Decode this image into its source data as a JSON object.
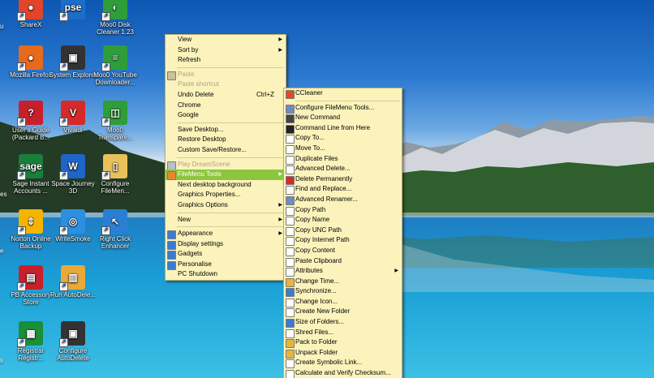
{
  "desktop": {
    "colors": {
      "menu_bg": "#fbf3bb",
      "highlight": "#8cc63e"
    },
    "edge_labels": [
      "u",
      "es",
      "e",
      "s"
    ],
    "icons": [
      {
        "label": "ShareX",
        "color": "#e0452c",
        "glyph": "●",
        "name": "sharex-icon"
      },
      {
        "label": "Mozilla Firefox",
        "color": "#e66a1d",
        "glyph": "●",
        "name": "firefox-icon"
      },
      {
        "label": "User's Guide (Packard B...",
        "color": "#c8202a",
        "glyph": "?",
        "name": "help-icon"
      },
      {
        "label": "Sage Instant Accounts ...",
        "color": "#1a7f3c",
        "glyph": "sage",
        "name": "sage-icon"
      },
      {
        "label": "Norton Online Backup",
        "color": "#f4b400",
        "glyph": "⇕",
        "name": "norton-icon"
      },
      {
        "label": "PB Accessory Store",
        "color": "#c8202a",
        "glyph": "▤",
        "name": "store-icon"
      },
      {
        "label": "Registrar Registr...",
        "color": "#1a8f3a",
        "glyph": "▦",
        "name": "registrar-icon"
      },
      {
        "label": "",
        "color": "#1b6fc8",
        "glyph": "pse",
        "name": "pse-icon"
      },
      {
        "label": "System Explorer",
        "color": "#333333",
        "glyph": "▣",
        "name": "system-explorer-icon"
      },
      {
        "label": "Vivaldi",
        "color": "#d42a2a",
        "glyph": "V",
        "name": "vivaldi-icon"
      },
      {
        "label": "Space Journey 3D",
        "color": "#1f64c8",
        "glyph": "W",
        "name": "space-journey-icon"
      },
      {
        "label": "WriteSmoke",
        "color": "#2c8fe0",
        "glyph": "◎",
        "name": "writesmoke-icon"
      },
      {
        "label": "Run AutoDele...",
        "color": "#e8a93a",
        "glyph": "▥",
        "name": "autodelete-run-icon"
      },
      {
        "label": "Configure AutoDelete",
        "color": "#333333",
        "glyph": "▣",
        "name": "configure-autodelete-icon"
      },
      {
        "label": "Moo0 Disk Cleaner 1.23",
        "color": "#2e9d3a",
        "glyph": "◐",
        "name": "moo0-disk-icon"
      },
      {
        "label": "Moo0 YouTube Downloader...",
        "color": "#2e9d3a",
        "glyph": "≡",
        "name": "moo0-youtube-icon"
      },
      {
        "label": "Moo0 Transpare...",
        "color": "#2e9d3a",
        "glyph": "◫",
        "name": "moo0-transparent-icon"
      },
      {
        "label": "Configure FileMen...",
        "color": "#e8c15a",
        "glyph": "▯",
        "name": "configure-filemenu-icon"
      },
      {
        "label": "Right Click Enhancer",
        "color": "#2a7fd4",
        "glyph": "↖",
        "name": "right-click-enhancer-icon"
      }
    ]
  },
  "context_menu": {
    "items": [
      {
        "label": "View",
        "arrow": true
      },
      {
        "label": "Sort by",
        "arrow": true
      },
      {
        "label": "Refresh"
      },
      {
        "sep": true
      },
      {
        "label": "Paste",
        "disabled": true,
        "icon": "#c9c19a",
        "icon_name": "paste-icon"
      },
      {
        "label": "Paste shortcut",
        "disabled": true
      },
      {
        "label": "Undo Delete",
        "shortcut": "Ctrl+Z"
      },
      {
        "label": "Chrome"
      },
      {
        "label": "Google"
      },
      {
        "sep": true
      },
      {
        "label": "Save Desktop..."
      },
      {
        "label": "Restore Desktop"
      },
      {
        "label": "Custom Save/Restore..."
      },
      {
        "sep": true
      },
      {
        "label": "Play DreamScene",
        "disabled": true,
        "icon": "#b7c0c8",
        "icon_name": "dreamscene-icon"
      },
      {
        "label": "FileMenu Tools",
        "arrow": true,
        "highlighted": true,
        "icon": "#e38a2e",
        "icon_name": "filemenu-icon"
      },
      {
        "label": "Next desktop background"
      },
      {
        "label": "Graphics Properties..."
      },
      {
        "label": "Graphics Options",
        "arrow": true
      },
      {
        "sep": true
      },
      {
        "label": "New",
        "arrow": true
      },
      {
        "sep": true
      },
      {
        "label": "Appearance",
        "arrow": true,
        "icon": "#3c7bd1",
        "icon_name": "appearance-icon"
      },
      {
        "label": "Display settings",
        "icon": "#3c7bd1",
        "icon_name": "display-icon"
      },
      {
        "label": "Gadgets",
        "icon": "#3c7bd1",
        "icon_name": "gadgets-icon"
      },
      {
        "label": "Personalise",
        "icon": "#3c7bd1",
        "icon_name": "personalise-icon"
      },
      {
        "label": "PC Shutdown"
      }
    ]
  },
  "filemenu_submenu": {
    "items": [
      {
        "label": "CCleaner",
        "icon": "#e04b2a",
        "icon_name": "ccleaner-icon"
      },
      {
        "sep": true
      },
      {
        "label": "Configure FileMenu Tools...",
        "icon": "#6c8ebf",
        "icon_name": "configure-icon"
      },
      {
        "label": "New Command",
        "icon": "#444444",
        "icon_name": "new-command-icon"
      },
      {
        "label": "Command Line from Here",
        "icon": "#222222",
        "icon_name": "command-line-icon"
      },
      {
        "label": "Copy To...",
        "icon": "#ffffff",
        "icon_name": "copy-to-icon"
      },
      {
        "label": "Move To...",
        "icon": "#ffffff",
        "icon_name": "move-to-icon"
      },
      {
        "label": "Duplicate Files",
        "icon": "#ffffff",
        "icon_name": "duplicate-icon"
      },
      {
        "label": "Advanced Delete...",
        "icon": "#ffffff",
        "icon_name": "advanced-delete-icon"
      },
      {
        "label": "Delete Permanently",
        "icon": "#d42a2a",
        "icon_name": "delete-icon"
      },
      {
        "label": "Find and Replace...",
        "icon": "#ffffff",
        "icon_name": "find-replace-icon"
      },
      {
        "label": "Advanced Renamer...",
        "icon": "#6c8ebf",
        "icon_name": "renamer-icon"
      },
      {
        "label": "Copy Path",
        "icon": "#ffffff",
        "icon_name": "copy-path-icon"
      },
      {
        "label": "Copy Name",
        "icon": "#ffffff",
        "icon_name": "copy-name-icon"
      },
      {
        "label": "Copy UNC Path",
        "icon": "#ffffff",
        "icon_name": "copy-unc-icon"
      },
      {
        "label": "Copy Internet Path",
        "icon": "#ffffff",
        "icon_name": "copy-internet-icon"
      },
      {
        "label": "Copy Content",
        "icon": "#ffffff",
        "icon_name": "copy-content-icon"
      },
      {
        "label": "Paste Clipboard",
        "icon": "#ffffff",
        "icon_name": "paste-clipboard-icon"
      },
      {
        "label": "Attributes",
        "arrow": true,
        "icon": "#ffffff",
        "icon_name": "attributes-icon"
      },
      {
        "label": "Change Time...",
        "icon": "#e6b53a",
        "icon_name": "clock-icon"
      },
      {
        "label": "Synchronize...",
        "icon": "#3c7bd1",
        "icon_name": "sync-icon"
      },
      {
        "label": "Change Icon...",
        "icon": "#ffffff",
        "icon_name": "change-icon-icon"
      },
      {
        "label": "Create New Folder",
        "icon": "#ffffff",
        "icon_name": "new-folder-icon"
      },
      {
        "label": "Size of Folders...",
        "icon": "#3c7bd1",
        "icon_name": "size-icon"
      },
      {
        "label": "Shred Files...",
        "icon": "#ffffff",
        "icon_name": "shred-icon"
      },
      {
        "label": "Pack to Folder",
        "icon": "#e6b53a",
        "icon_name": "pack-icon"
      },
      {
        "label": "Unpack Folder",
        "icon": "#e6b53a",
        "icon_name": "unpack-icon"
      },
      {
        "label": "Create Symbolic Link...",
        "icon": "#ffffff",
        "icon_name": "symlink-icon"
      },
      {
        "label": "Calculate and Verify Checksum...",
        "icon": "#ffffff",
        "icon_name": "checksum-icon"
      }
    ]
  }
}
